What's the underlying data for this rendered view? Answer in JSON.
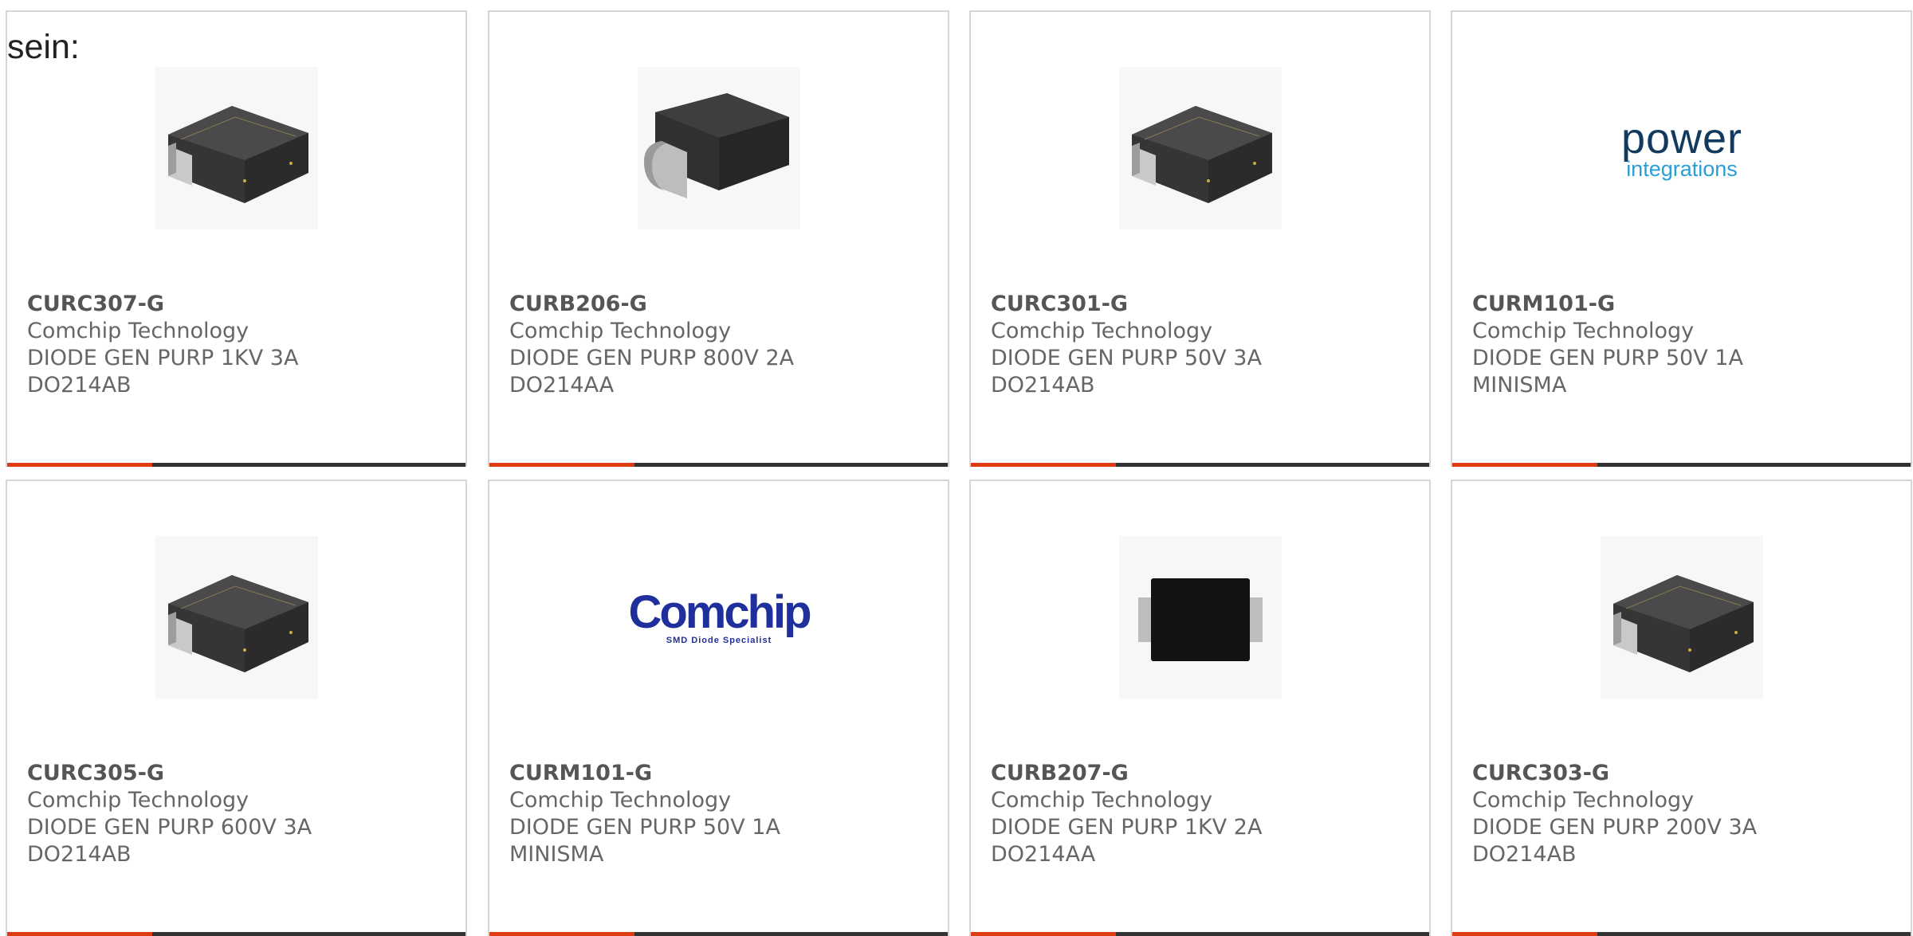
{
  "intro_text": "sein:",
  "colors": {
    "accent": "#dd3b12",
    "bar": "#333333",
    "border": "#d6d6d6",
    "text": "#666666"
  },
  "products": [
    {
      "part": "CURC307-G",
      "manufacturer": "Comchip Technology",
      "description": "DIODE GEN PURP 1KV 3A",
      "package": "DO214AB",
      "image": "diode-smc-icon"
    },
    {
      "part": "CURB206-G",
      "manufacturer": "Comchip Technology",
      "description": "DIODE GEN PURP 800V 2A",
      "package": "DO214AA",
      "image": "diode-smb-icon"
    },
    {
      "part": "CURC301-G",
      "manufacturer": "Comchip Technology",
      "description": "DIODE GEN PURP 50V 3A",
      "package": "DO214AB",
      "image": "diode-smc-icon"
    },
    {
      "part": "CURM101-G",
      "manufacturer": "Comchip Technology",
      "description": "DIODE GEN PURP 50V 1A",
      "package": "MINISMA",
      "image": "power-integrations-logo",
      "logo": {
        "line1": "power",
        "line2": "integrations"
      }
    },
    {
      "part": "CURC305-G",
      "manufacturer": "Comchip Technology",
      "description": "DIODE GEN PURP 600V 3A",
      "package": "DO214AB",
      "image": "diode-smc-icon"
    },
    {
      "part": "CURM101-G",
      "manufacturer": "Comchip Technology",
      "description": "DIODE GEN PURP 50V 1A",
      "package": "MINISMA",
      "image": "comchip-logo",
      "logo": {
        "line1": "Comchip",
        "line2": "SMD Diode Specialist"
      }
    },
    {
      "part": "CURB207-G",
      "manufacturer": "Comchip Technology",
      "description": "DIODE GEN PURP 1KV 2A",
      "package": "DO214AA",
      "image": "diode-top-view-icon"
    },
    {
      "part": "CURC303-G",
      "manufacturer": "Comchip Technology",
      "description": "DIODE GEN PURP 200V 3A",
      "package": "DO214AB",
      "image": "diode-smc-icon"
    }
  ]
}
